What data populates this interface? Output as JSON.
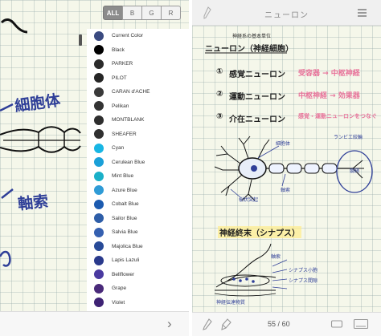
{
  "left": {
    "filter_tabs": [
      "ALL",
      "B",
      "G",
      "R"
    ],
    "active_tab": "ALL",
    "handwriting": [
      "細胞体",
      "軸索"
    ],
    "colors": [
      {
        "name": "Current Color",
        "hex": "#3a4a80"
      },
      {
        "name": "Black",
        "hex": "#000000"
      },
      {
        "name": "PARKER",
        "hex": "#2b2b2b"
      },
      {
        "name": "PILOT",
        "hex": "#262626"
      },
      {
        "name": "CARAN d'ACHE",
        "hex": "#3a3a3a"
      },
      {
        "name": "Pelikan",
        "hex": "#333333"
      },
      {
        "name": "MONTBLANK",
        "hex": "#2e2e2e"
      },
      {
        "name": "SHEAFER",
        "hex": "#303030"
      },
      {
        "name": "Cyan",
        "hex": "#18b6e4"
      },
      {
        "name": "Cerulean Blue",
        "hex": "#1aa0d8"
      },
      {
        "name": "Mint Blue",
        "hex": "#1ab0c8"
      },
      {
        "name": "Azure Blue",
        "hex": "#2f9bd6"
      },
      {
        "name": "Cobalt Blue",
        "hex": "#1c5bb0"
      },
      {
        "name": "Sailor Blue",
        "hex": "#2e5ea8"
      },
      {
        "name": "Salvia Blue",
        "hex": "#3560b0"
      },
      {
        "name": "Majolica Blue",
        "hex": "#284a98"
      },
      {
        "name": "Lapis Lazuli",
        "hex": "#2a3a8c"
      },
      {
        "name": "Bellflower",
        "hex": "#4a3aa0"
      },
      {
        "name": "Grape",
        "hex": "#4a2a7a"
      },
      {
        "name": "Violet",
        "hex": "#3e2274"
      }
    ],
    "next_icon": "chevron-right-icon"
  },
  "right": {
    "title": "ニューロン",
    "header_icons": [
      "pen-icon",
      "menu-icon"
    ],
    "notes": {
      "heading_small": "神経系の基本単位",
      "heading": "ニューロン（神経細胞）",
      "items": [
        {
          "num": "①",
          "term": "感覚ニューロン",
          "desc": "受容器 → 中枢神経"
        },
        {
          "num": "②",
          "term": "運動ニューロン",
          "desc": "中枢神経 → 効果器"
        },
        {
          "num": "③",
          "term": "介在ニューロン",
          "desc": "感覚・運動ニューロンをつなぐ"
        }
      ],
      "diagram_labels": [
        "細胞体",
        "樹状突起",
        "軸索",
        "ランビエ絞輪",
        "髄鞘"
      ],
      "heading2": "神経終末（シナプス）",
      "diagram2_labels": [
        "軸索",
        "シナプス小胞",
        "シナプス間隙",
        "神経伝達物質"
      ]
    },
    "page_current": "55",
    "page_sep": "/",
    "page_total": "60",
    "bottom_icons": [
      "pen-tool-icon",
      "highlighter-icon",
      "eraser-icon",
      "page-icon",
      "screen-icon"
    ]
  }
}
